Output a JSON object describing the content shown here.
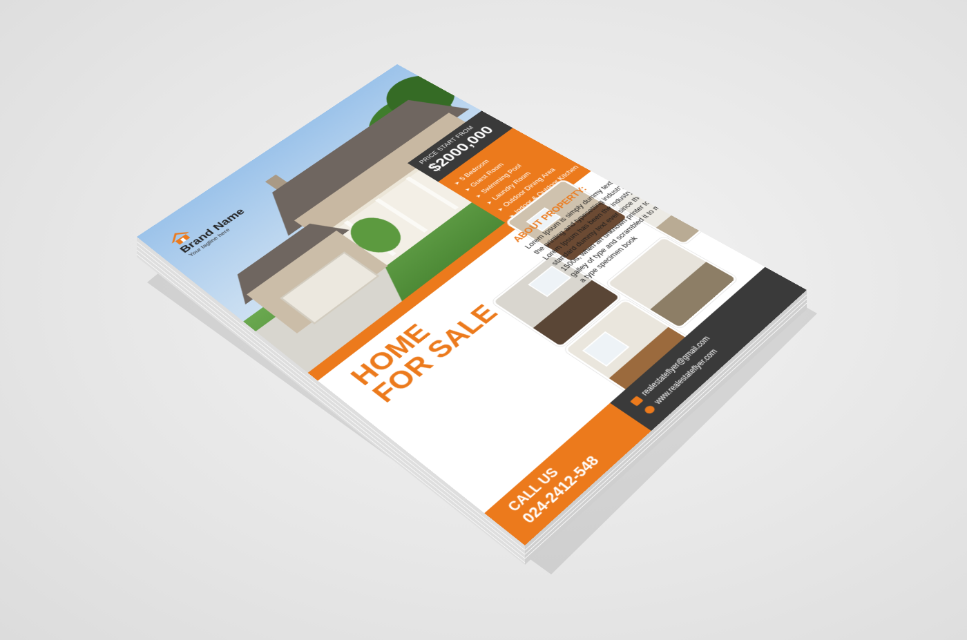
{
  "flyer": {
    "brand": {
      "logo_icon": "house-logo-icon",
      "name": "Brand Name",
      "tagline": "Your tagline here"
    },
    "price": {
      "label": "PRICE START FROM",
      "value": "$2000,000"
    },
    "features": [
      "5 Bedroom",
      "Guest Room",
      "Swimming Pool",
      "Laundry Room",
      "Outdoor Dining Area",
      "Indoor & Outdoor Kitchen"
    ],
    "headline": {
      "line1": "HOME",
      "line2": "FOR SALE"
    },
    "about": {
      "title": "ABOUT PROPERTY:",
      "body": "Lorem Ipsum is simply dummy text of the printing and typesetting industry. Lorem Ipsum has been the industry's standard dummy text ever since the 1500s, when an unknown printer took a galley of type and scrambled it to make a type specimen book"
    },
    "call": {
      "label": "CALL US",
      "number": "024-2412-548"
    },
    "contact": {
      "email": "realestateflyer@gmail.com",
      "website": "www.realestateflyer.com",
      "email_icon": "envelope-icon",
      "website_icon": "globe-icon"
    },
    "colors": {
      "accent": "#ec7a1c",
      "dark": "#3a3a3a",
      "paper": "#ffffff"
    }
  }
}
